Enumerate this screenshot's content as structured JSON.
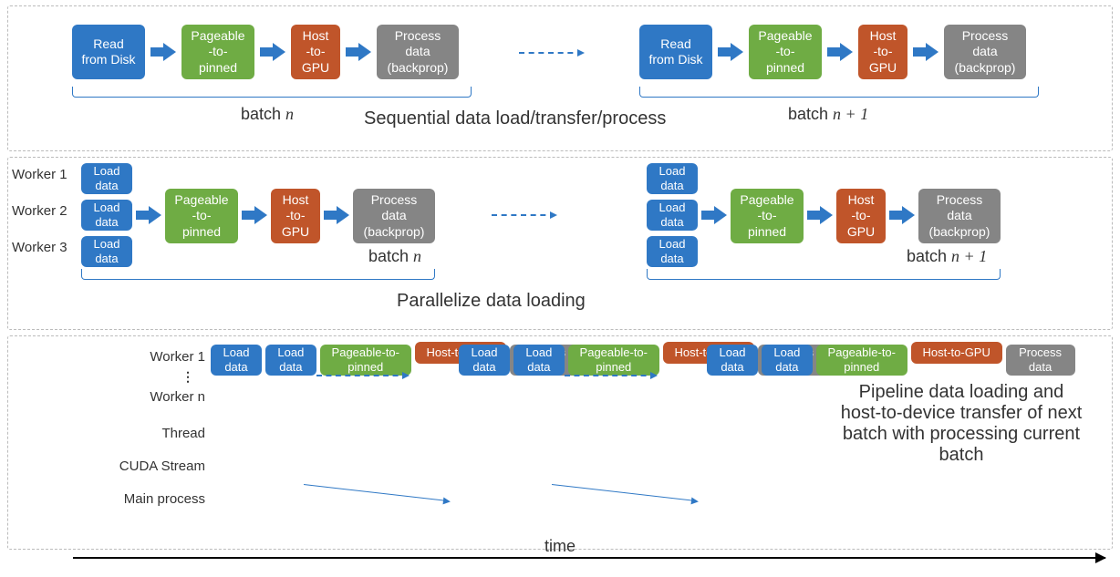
{
  "boxes": {
    "read_disk": "Read\nfrom Disk",
    "p2p": "Pageable\n-to-\npinned",
    "h2g": "Host\n-to-\nGPU",
    "process": "Process\ndata\n(backprop)",
    "load": "Load\ndata",
    "p2p_flat": "Pageable-to-\npinned",
    "h2g_flat": "Host-to-GPU",
    "process_short": "Process\ndata"
  },
  "labels": {
    "batch_n": "batch ",
    "batch_np1": "batch ",
    "n": "n",
    "np1": "n + 1",
    "caption1": "Sequential data load/transfer/process",
    "caption2": "Parallelize data loading",
    "caption3": "Pipeline data loading and host-to-device transfer of next batch with processing current batch",
    "worker1": "Worker 1",
    "worker2": "Worker 2",
    "worker3": "Worker 3",
    "worker_n": "Worker n",
    "thread": "Thread",
    "cuda": "CUDA Stream",
    "main": "Main process",
    "time": "time"
  }
}
